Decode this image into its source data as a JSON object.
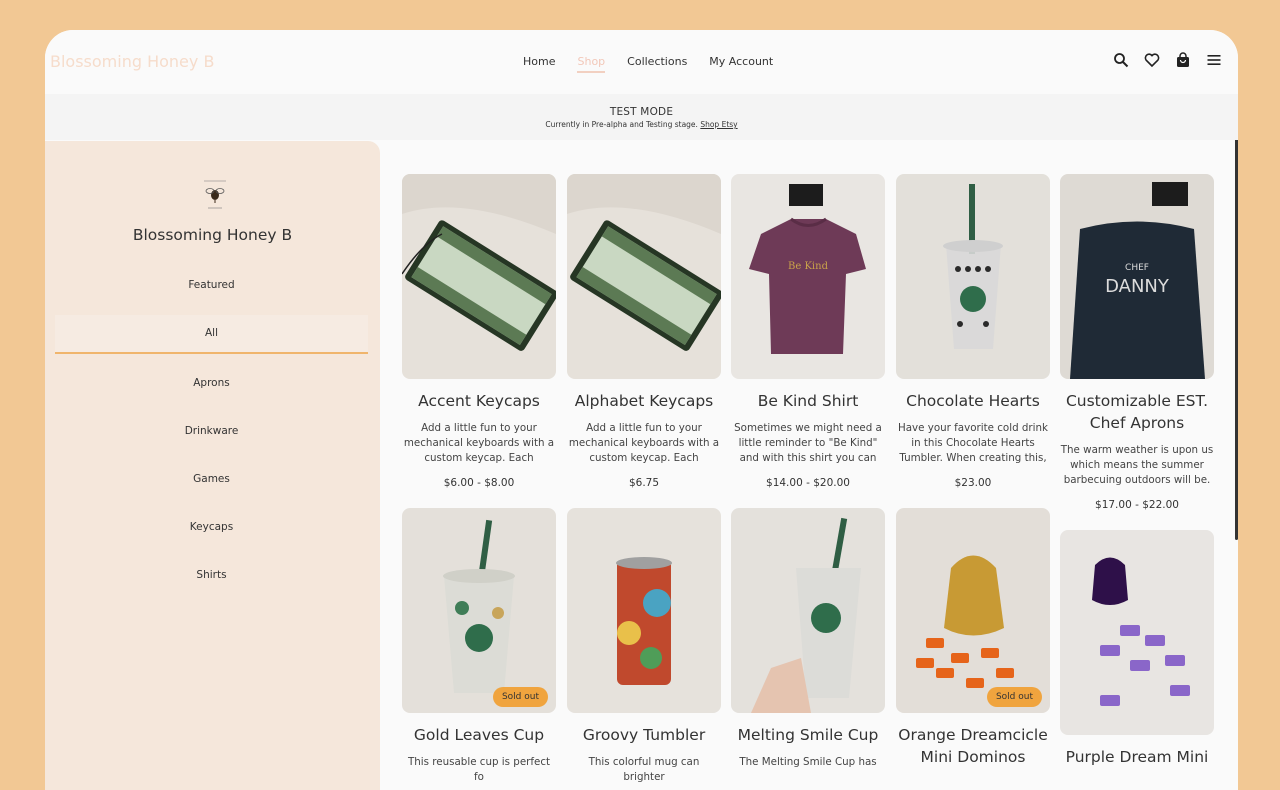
{
  "header": {
    "logo": "Blossoming Honey B",
    "nav": [
      "Home",
      "Shop",
      "Collections",
      "My Account"
    ],
    "active_nav": "Shop",
    "icons": [
      "search-icon",
      "heart-icon",
      "bag-icon",
      "menu-icon"
    ]
  },
  "banner": {
    "title": "TEST MODE",
    "text": "Currently in Pre-alpha and Testing stage.",
    "link": "Shop Etsy"
  },
  "sidebar": {
    "title": "Blossoming Honey B",
    "categories": [
      "Featured",
      "All",
      "Aprons",
      "Drinkware",
      "Games",
      "Keycaps",
      "Shirts"
    ],
    "selected": "All"
  },
  "products": [
    {
      "name": "Accent Keycaps",
      "desc": "Add a little fun to your mechanical keyboards with a custom keycap. Each keycaps",
      "price": "$6.00 - $8.00",
      "sold_out": ""
    },
    {
      "name": "Alphabet Keycaps",
      "desc": "Add a little fun to your mechanical keyboards with a custom keycap. Each keycaps",
      "price": "$6.75",
      "sold_out": ""
    },
    {
      "name": "Be Kind Shirt",
      "desc": "Sometimes we might need a little reminder to \"Be Kind\" and with this shirt you can share.",
      "price": "$14.00 - $20.00",
      "sold_out": ""
    },
    {
      "name": "Chocolate Hearts",
      "desc": "Have your favorite cold drink in this Chocolate Hearts Tumbler. When creating this,",
      "price": "$23.00",
      "sold_out": ""
    },
    {
      "name": "Customizable EST. Chef Aprons",
      "desc": "The warm weather is upon us which means the summer barbecuing outdoors will be.",
      "price": "$17.00 - $22.00",
      "sold_out": ""
    },
    {
      "name": "Gold Leaves Cup",
      "desc": "This reusable cup is perfect fo",
      "price": "",
      "sold_out": "Sold out"
    },
    {
      "name": "Groovy Tumbler",
      "desc": "This colorful mug can brighter",
      "price": "",
      "sold_out": ""
    },
    {
      "name": "Melting Smile Cup",
      "desc": "The Melting Smile Cup has",
      "price": "",
      "sold_out": ""
    },
    {
      "name": "Orange Dreamcicle Mini Dominos",
      "desc": "",
      "price": "",
      "sold_out": "Sold out"
    },
    {
      "name": "Purple Dream Mini",
      "desc": "",
      "price": "",
      "sold_out": ""
    }
  ]
}
